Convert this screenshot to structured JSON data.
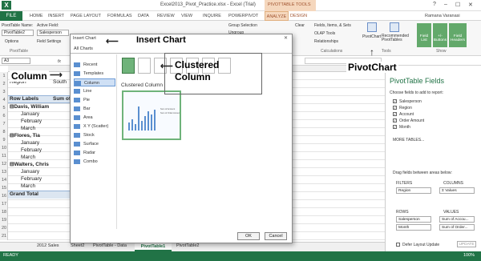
{
  "window": {
    "title": "Excel2013_Pivot_Practice.xlsx - Excel (Trial)",
    "context_tools": "PIVOTTABLE TOOLS",
    "user": "Ramana Varanasi",
    "controls": [
      "?",
      "–",
      "☐",
      "✕"
    ]
  },
  "tabs": {
    "file": "FILE",
    "items": [
      "HOME",
      "INSERT",
      "PAGE LAYOUT",
      "FORMULAS",
      "DATA",
      "REVIEW",
      "VIEW",
      "INQUIRE",
      "POWERPIVOT"
    ],
    "analyze": "ANALYZE",
    "design": "DESIGN"
  },
  "ribbon": {
    "pt_name_label": "PivotTable Name:",
    "pt_name_value": "PivotTable2",
    "options_label": "Options",
    "active_field_label": "Active Field:",
    "active_field_value": "Salesperson",
    "field_settings": "Field Settings",
    "group_selection": "Group Selection",
    "ungroup": "Ungroup",
    "clear": "Clear",
    "fields_items": "Fields, Items, & Sets",
    "olap_tools": "OLAP Tools",
    "relationships": "Relationships",
    "pivotchart": "PivotChart",
    "recommended": "Recommended PivotTables",
    "field_list": "Field List",
    "buttons": "+/- Buttons",
    "field_headers": "Field Headers",
    "groups": [
      "PivotTable",
      "Calculations",
      "Tools",
      "Show"
    ]
  },
  "formula_bar": {
    "name_box": "A3",
    "fx": "fx"
  },
  "grid": {
    "row_numbers": [
      "1",
      "2",
      "3",
      "4",
      "5",
      "6",
      "7",
      "8",
      "9",
      "10",
      "11",
      "12",
      "13",
      "14",
      "15",
      "16",
      "17",
      "18",
      "19",
      "20",
      "21"
    ],
    "region_label": "Region",
    "region_value": "South",
    "row_labels_header": "Row Labels",
    "sum_header": "Sum of",
    "rows": [
      {
        "text": "⊟Davis, William",
        "bold": true,
        "indent": 0
      },
      {
        "text": "January",
        "bold": false,
        "indent": 1
      },
      {
        "text": "February",
        "bold": false,
        "indent": 1
      },
      {
        "text": "March",
        "bold": false,
        "indent": 1
      },
      {
        "text": "⊟Flores, Tia",
        "bold": true,
        "indent": 0
      },
      {
        "text": "January",
        "bold": false,
        "indent": 1
      },
      {
        "text": "February",
        "bold": false,
        "indent": 1
      },
      {
        "text": "March",
        "bold": false,
        "indent": 1
      },
      {
        "text": "⊟Walters, Chris",
        "bold": true,
        "indent": 0
      },
      {
        "text": "January",
        "bold": false,
        "indent": 1
      },
      {
        "text": "February",
        "bold": false,
        "indent": 1
      },
      {
        "text": "March",
        "bold": false,
        "indent": 1
      }
    ],
    "grand_total": "Grand Total"
  },
  "sheets": {
    "tabs": [
      "2012 Sales",
      "Sheet2",
      "PivotTable - Data",
      "PivotTable1",
      "PivotTable2"
    ],
    "active": "PivotTable1"
  },
  "status": {
    "ready": "READY",
    "zoom": "100%"
  },
  "pane": {
    "title": "PivotTable Fields",
    "choose": "Choose fields to add to report:",
    "fields": [
      {
        "name": "Salesperson",
        "checked": true
      },
      {
        "name": "Region",
        "checked": true
      },
      {
        "name": "Account",
        "checked": true
      },
      {
        "name": "Order Amount",
        "checked": true
      },
      {
        "name": "Month",
        "checked": true
      }
    ],
    "more_tables": "MORE TABLES...",
    "drag_label": "Drag fields between areas below:",
    "filters_label": "FILTERS",
    "columns_label": "COLUMNS",
    "filters_value": "Region",
    "columns_value": "Σ Values",
    "rows_label": "ROWS",
    "values_label": "VALUES",
    "rows_values": [
      "Salesperson",
      "Month"
    ],
    "values_values": [
      "Sum of Accou...",
      "Sum of Order..."
    ],
    "defer": "Defer Layout Update",
    "update": "UPDATE"
  },
  "dialog": {
    "title": "Insert Chart",
    "tab": "All Charts",
    "chart_types": [
      "Recent",
      "Templates",
      "Column",
      "Line",
      "Pie",
      "Bar",
      "Area",
      "X Y (Scatter)",
      "Stock",
      "Surface",
      "Radar",
      "Combo"
    ],
    "selected_type": "Column",
    "subtype_title": "Clustered Column",
    "ok": "OK",
    "cancel": "Cancel",
    "legend_items": [
      "Sum of Account",
      "Sum of Order Amount"
    ]
  },
  "annotations": {
    "insert_chart": "Insert Chart",
    "column": "Column",
    "clustered_column": "Clustered Column",
    "pivotchart": "PivotChart"
  },
  "colors": {
    "excel_green": "#217346",
    "context_orange": "#f5d7bd",
    "selection_green": "#6fb37a",
    "chart_blue": "#5a8fd0"
  }
}
